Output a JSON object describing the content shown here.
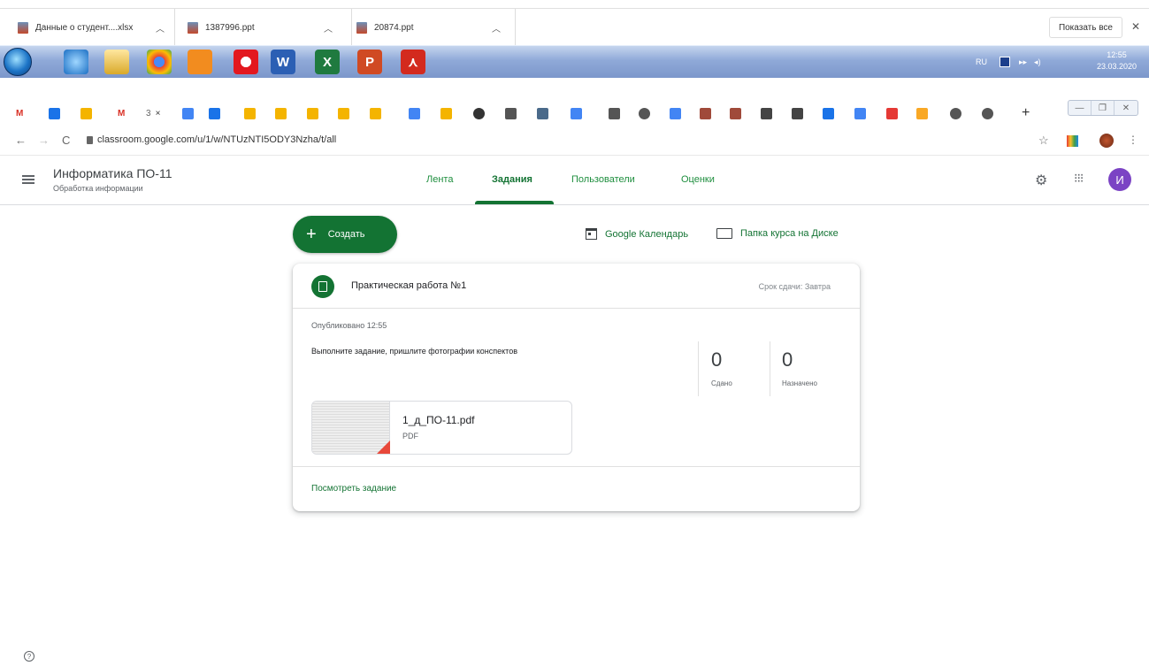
{
  "downloads": {
    "items": [
      {
        "name": "Данные о студент....xlsx"
      },
      {
        "name": "1387996.ppt"
      },
      {
        "name": "20874.ppt"
      }
    ],
    "show_all": "Показать все",
    "close": "✕"
  },
  "taskbar": {
    "apps": [
      "ie-icon",
      "explorer-icon",
      "chrome-icon",
      "player-icon",
      "opera-icon",
      "word-icon",
      "excel-icon",
      "powerpoint-icon",
      "acrobat-icon"
    ],
    "lang": "RU",
    "time": "12:55",
    "date": "23.03.2020"
  },
  "browser": {
    "tab_labels": [
      "М",
      "3",
      "×"
    ],
    "new_tab": "+",
    "url": "classroom.google.com/u/1/w/NTUzNTI5ODY3Nzha/t/all"
  },
  "header": {
    "course_title": "Информатика ПО-11",
    "course_subtitle": "Обработка информации",
    "tabs": [
      "Лента",
      "Задания",
      "Пользователи",
      "Оценки"
    ],
    "active_tab": "Задания",
    "avatar_letter": "И"
  },
  "toolbar": {
    "create_label": "Создать",
    "calendar_label": "Google Календарь",
    "drive_label": "Папка курса на Диске"
  },
  "assignment": {
    "title": "Практическая работа №1",
    "due": "Срок сдачи: Завтра",
    "published": "Опубликовано 12:55",
    "instructions": "Выполните задание, пришлите фотографии конспектов",
    "stats": [
      {
        "value": "0",
        "label": "Сдано"
      },
      {
        "value": "0",
        "label": "Назначено"
      }
    ],
    "attachment": {
      "name": "1_д_ПО-11.pdf",
      "type": "PDF"
    },
    "view_link": "Посмотреть задание"
  },
  "colors": {
    "accent": "#137333",
    "avatar": "#7b43c4"
  }
}
